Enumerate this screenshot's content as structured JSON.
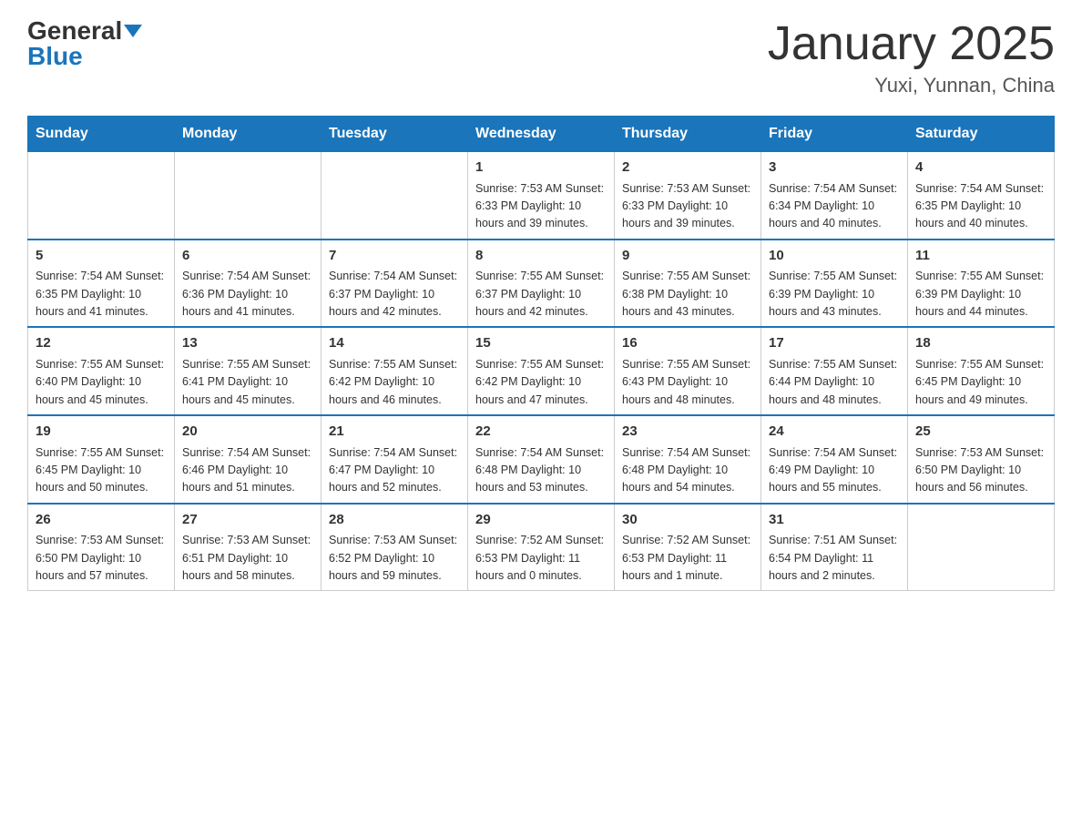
{
  "header": {
    "logo_general": "General",
    "logo_blue": "Blue",
    "month_title": "January 2025",
    "location": "Yuxi, Yunnan, China"
  },
  "days_of_week": [
    "Sunday",
    "Monday",
    "Tuesday",
    "Wednesday",
    "Thursday",
    "Friday",
    "Saturday"
  ],
  "weeks": [
    [
      {
        "day": "",
        "info": ""
      },
      {
        "day": "",
        "info": ""
      },
      {
        "day": "",
        "info": ""
      },
      {
        "day": "1",
        "info": "Sunrise: 7:53 AM\nSunset: 6:33 PM\nDaylight: 10 hours\nand 39 minutes."
      },
      {
        "day": "2",
        "info": "Sunrise: 7:53 AM\nSunset: 6:33 PM\nDaylight: 10 hours\nand 39 minutes."
      },
      {
        "day": "3",
        "info": "Sunrise: 7:54 AM\nSunset: 6:34 PM\nDaylight: 10 hours\nand 40 minutes."
      },
      {
        "day": "4",
        "info": "Sunrise: 7:54 AM\nSunset: 6:35 PM\nDaylight: 10 hours\nand 40 minutes."
      }
    ],
    [
      {
        "day": "5",
        "info": "Sunrise: 7:54 AM\nSunset: 6:35 PM\nDaylight: 10 hours\nand 41 minutes."
      },
      {
        "day": "6",
        "info": "Sunrise: 7:54 AM\nSunset: 6:36 PM\nDaylight: 10 hours\nand 41 minutes."
      },
      {
        "day": "7",
        "info": "Sunrise: 7:54 AM\nSunset: 6:37 PM\nDaylight: 10 hours\nand 42 minutes."
      },
      {
        "day": "8",
        "info": "Sunrise: 7:55 AM\nSunset: 6:37 PM\nDaylight: 10 hours\nand 42 minutes."
      },
      {
        "day": "9",
        "info": "Sunrise: 7:55 AM\nSunset: 6:38 PM\nDaylight: 10 hours\nand 43 minutes."
      },
      {
        "day": "10",
        "info": "Sunrise: 7:55 AM\nSunset: 6:39 PM\nDaylight: 10 hours\nand 43 minutes."
      },
      {
        "day": "11",
        "info": "Sunrise: 7:55 AM\nSunset: 6:39 PM\nDaylight: 10 hours\nand 44 minutes."
      }
    ],
    [
      {
        "day": "12",
        "info": "Sunrise: 7:55 AM\nSunset: 6:40 PM\nDaylight: 10 hours\nand 45 minutes."
      },
      {
        "day": "13",
        "info": "Sunrise: 7:55 AM\nSunset: 6:41 PM\nDaylight: 10 hours\nand 45 minutes."
      },
      {
        "day": "14",
        "info": "Sunrise: 7:55 AM\nSunset: 6:42 PM\nDaylight: 10 hours\nand 46 minutes."
      },
      {
        "day": "15",
        "info": "Sunrise: 7:55 AM\nSunset: 6:42 PM\nDaylight: 10 hours\nand 47 minutes."
      },
      {
        "day": "16",
        "info": "Sunrise: 7:55 AM\nSunset: 6:43 PM\nDaylight: 10 hours\nand 48 minutes."
      },
      {
        "day": "17",
        "info": "Sunrise: 7:55 AM\nSunset: 6:44 PM\nDaylight: 10 hours\nand 48 minutes."
      },
      {
        "day": "18",
        "info": "Sunrise: 7:55 AM\nSunset: 6:45 PM\nDaylight: 10 hours\nand 49 minutes."
      }
    ],
    [
      {
        "day": "19",
        "info": "Sunrise: 7:55 AM\nSunset: 6:45 PM\nDaylight: 10 hours\nand 50 minutes."
      },
      {
        "day": "20",
        "info": "Sunrise: 7:54 AM\nSunset: 6:46 PM\nDaylight: 10 hours\nand 51 minutes."
      },
      {
        "day": "21",
        "info": "Sunrise: 7:54 AM\nSunset: 6:47 PM\nDaylight: 10 hours\nand 52 minutes."
      },
      {
        "day": "22",
        "info": "Sunrise: 7:54 AM\nSunset: 6:48 PM\nDaylight: 10 hours\nand 53 minutes."
      },
      {
        "day": "23",
        "info": "Sunrise: 7:54 AM\nSunset: 6:48 PM\nDaylight: 10 hours\nand 54 minutes."
      },
      {
        "day": "24",
        "info": "Sunrise: 7:54 AM\nSunset: 6:49 PM\nDaylight: 10 hours\nand 55 minutes."
      },
      {
        "day": "25",
        "info": "Sunrise: 7:53 AM\nSunset: 6:50 PM\nDaylight: 10 hours\nand 56 minutes."
      }
    ],
    [
      {
        "day": "26",
        "info": "Sunrise: 7:53 AM\nSunset: 6:50 PM\nDaylight: 10 hours\nand 57 minutes."
      },
      {
        "day": "27",
        "info": "Sunrise: 7:53 AM\nSunset: 6:51 PM\nDaylight: 10 hours\nand 58 minutes."
      },
      {
        "day": "28",
        "info": "Sunrise: 7:53 AM\nSunset: 6:52 PM\nDaylight: 10 hours\nand 59 minutes."
      },
      {
        "day": "29",
        "info": "Sunrise: 7:52 AM\nSunset: 6:53 PM\nDaylight: 11 hours\nand 0 minutes."
      },
      {
        "day": "30",
        "info": "Sunrise: 7:52 AM\nSunset: 6:53 PM\nDaylight: 11 hours\nand 1 minute."
      },
      {
        "day": "31",
        "info": "Sunrise: 7:51 AM\nSunset: 6:54 PM\nDaylight: 11 hours\nand 2 minutes."
      },
      {
        "day": "",
        "info": ""
      }
    ]
  ]
}
